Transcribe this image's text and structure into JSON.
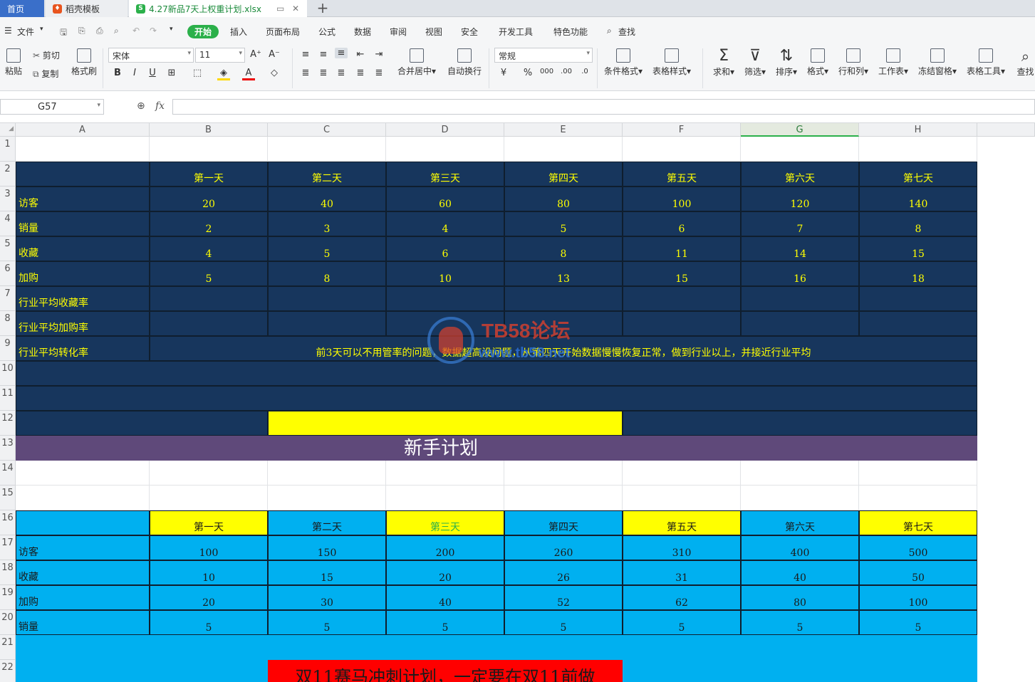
{
  "tabs": {
    "home": "首页",
    "daoke": "稻壳模板",
    "doc": "4.27新品7天上权重计划.xlsx"
  },
  "menu": {
    "file": "文件",
    "items": [
      "开始",
      "插入",
      "页面布局",
      "公式",
      "数据",
      "审阅",
      "视图",
      "安全",
      "开发工具",
      "特色功能"
    ],
    "search": "查找"
  },
  "toolbar": {
    "paste": "粘贴",
    "cut": "剪切",
    "copy": "复制",
    "format_painter": "格式刷",
    "font_name": "宋体",
    "font_size": "11",
    "merge": "合并居中",
    "wrap": "自动换行",
    "number_format": "常规",
    "cond_format": "条件格式",
    "table_style": "表格样式",
    "sum": "求和",
    "filter": "筛选",
    "sort": "排序",
    "format": "格式",
    "rows_cols": "行和列",
    "worksheet": "工作表",
    "freeze": "冻结窗格",
    "table_tools": "表格工具",
    "find": "查找"
  },
  "formula_bar": {
    "name_box": "G57",
    "fx": "fx",
    "value": ""
  },
  "columns": [
    "A",
    "B",
    "C",
    "D",
    "E",
    "F",
    "G",
    "H"
  ],
  "rows": [
    "1",
    "2",
    "3",
    "4",
    "5",
    "6",
    "7",
    "8",
    "9",
    "10",
    "11",
    "12",
    "13",
    "14",
    "15",
    "16",
    "17",
    "18",
    "19",
    "20",
    "21",
    "22"
  ],
  "table1": {
    "days": [
      "第一天",
      "第二天",
      "第三天",
      "第四天",
      "第五天",
      "第六天",
      "第七天"
    ],
    "rows": [
      {
        "label": "访客",
        "values": [
          "20",
          "40",
          "60",
          "80",
          "100",
          "120",
          "140"
        ]
      },
      {
        "label": "销量",
        "values": [
          "2",
          "3",
          "4",
          "5",
          "6",
          "7",
          "8"
        ]
      },
      {
        "label": "收藏",
        "values": [
          "4",
          "5",
          "6",
          "8",
          "11",
          "14",
          "15"
        ]
      },
      {
        "label": "加购",
        "values": [
          "5",
          "8",
          "10",
          "13",
          "15",
          "16",
          "18"
        ]
      },
      {
        "label": "行业平均收藏率",
        "values": [
          "",
          "",
          "",
          "",
          "",
          "",
          ""
        ]
      },
      {
        "label": "行业平均加购率",
        "values": [
          "",
          "",
          "",
          "",
          "",
          "",
          ""
        ]
      }
    ],
    "conv_label": "行业平均转化率",
    "note": "前3天可以不用管率的问题，数据超高没问题，从第四天开始数据慢慢恢复正常，做到行业以上，并接近行业平均"
  },
  "banner": "新手计划",
  "table2": {
    "days": [
      "第一天",
      "第二天",
      "第三天",
      "第四天",
      "第五天",
      "第六天",
      "第七天"
    ],
    "rows": [
      {
        "label": "访客",
        "values": [
          "100",
          "150",
          "200",
          "260",
          "310",
          "400",
          "500"
        ]
      },
      {
        "label": "收藏",
        "values": [
          "10",
          "15",
          "20",
          "26",
          "31",
          "40",
          "50"
        ]
      },
      {
        "label": "加购",
        "values": [
          "20",
          "30",
          "40",
          "52",
          "62",
          "80",
          "100"
        ]
      },
      {
        "label": "销量",
        "values": [
          "5",
          "5",
          "5",
          "5",
          "5",
          "5",
          "5"
        ]
      }
    ]
  },
  "red_banner": "双11赛马冲刺计划，一定要在双11前做",
  "watermark": {
    "title": "TB58论坛",
    "url": "www.tb58.net"
  },
  "colors": {
    "navy": "#17365d",
    "yellow": "#ffff00",
    "purple": "#5f497a",
    "cyan": "#00b0f0",
    "red": "#ff0000",
    "accent": "#2bb04a"
  }
}
